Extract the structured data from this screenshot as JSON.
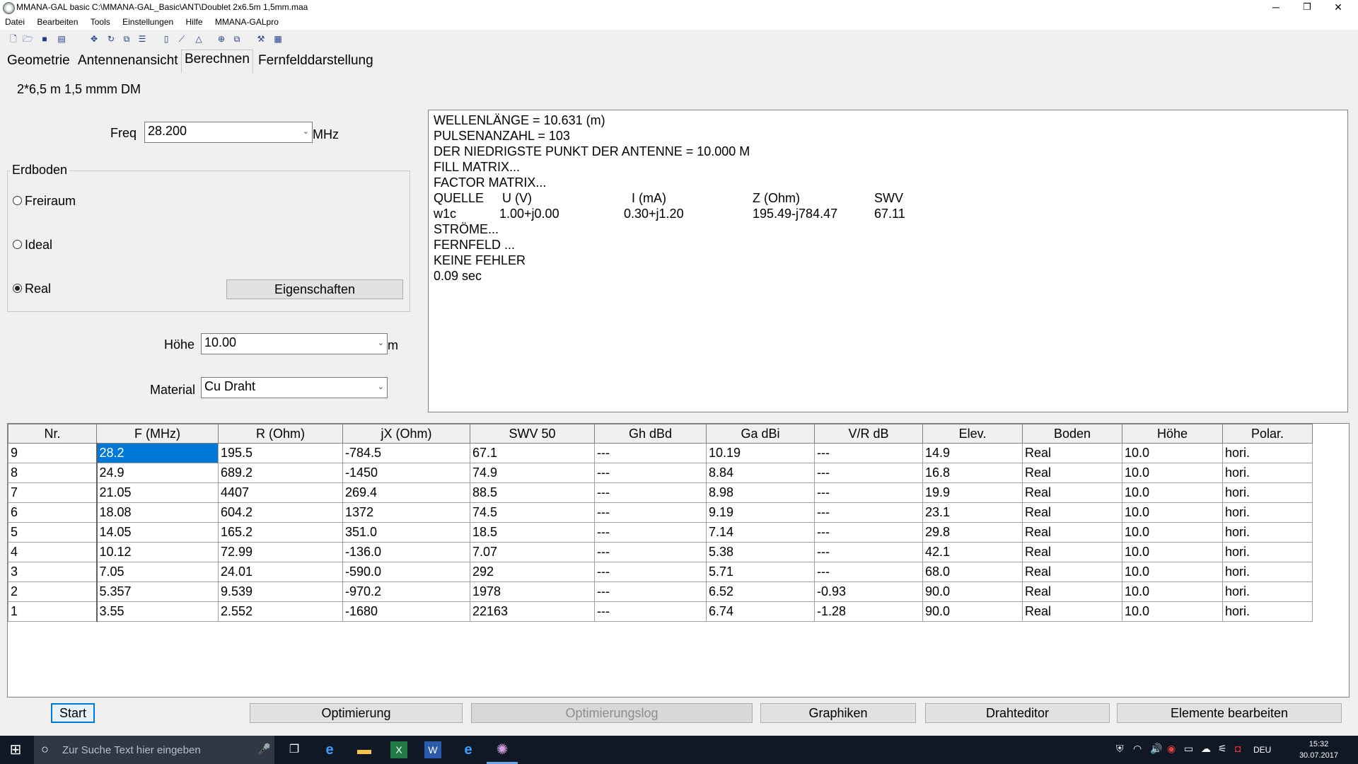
{
  "window": {
    "title": "MMANA-GAL basic C:\\MMANA-GAL_Basic\\ANT\\Doublet 2x6.5m 1,5mm.maa",
    "min": "─",
    "restore": "❐",
    "close": "✕"
  },
  "menu": [
    "Datei",
    "Bearbeiten",
    "Tools",
    "Einstellungen",
    "Hilfe",
    "MMANA-GALpro"
  ],
  "tabs": [
    "Geometrie",
    "Antennenansicht",
    "Berechnen",
    "Fernfelddarstellung"
  ],
  "active_tab": "Berechnen",
  "antenna_name": "2*6,5 m 1,5 mmm DM",
  "freq": {
    "label": "Freq",
    "value": "28.200",
    "unit": "MHz"
  },
  "ground": {
    "title": "Erdboden",
    "options": [
      "Freiraum",
      "Ideal",
      "Real"
    ],
    "selected": "Real",
    "properties_button": "Eigenschaften"
  },
  "height": {
    "label": "Höhe",
    "value": "10.00",
    "unit": "m"
  },
  "material": {
    "label": "Material",
    "value": "Cu Draht"
  },
  "output": {
    "lines": [
      "WELLENLÄNGE = 10.631 (m)",
      "PULSENANZAHL = 103",
      "DER NIEDRIGSTE PUNKT DER ANTENNE = 10.000 M",
      "FILL MATRIX...",
      "FACTOR MATRIX..."
    ],
    "source_header": [
      "QUELLE",
      "U (V)",
      "I (mA)",
      "Z (Ohm)",
      "SWV"
    ],
    "source_row": [
      "w1c",
      "1.00+j0.00",
      "0.30+j1.20",
      "195.49-j784.47",
      "67.11"
    ],
    "lines_after": [
      "STRÖME...",
      "FERNFELD ...",
      "KEINE FEHLER",
      "0.09 sec"
    ]
  },
  "table": {
    "headers": [
      "Nr.",
      "F (MHz)",
      "R (Ohm)",
      "jX (Ohm)",
      "SWV 50",
      "Gh dBd",
      "Ga dBi",
      "V/R dB",
      "Elev.",
      "Boden",
      "Höhe",
      "Polar."
    ],
    "rows": [
      [
        "9",
        "28.2",
        "195.5",
        "-784.5",
        "67.1",
        "---",
        "10.19",
        "---",
        "14.9",
        "Real",
        "10.0",
        "hori."
      ],
      [
        "8",
        "24.9",
        "689.2",
        "-1450",
        "74.9",
        "---",
        "8.84",
        "---",
        "16.8",
        "Real",
        "10.0",
        "hori."
      ],
      [
        "7",
        "21.05",
        "4407",
        "269.4",
        "88.5",
        "---",
        "8.98",
        "---",
        "19.9",
        "Real",
        "10.0",
        "hori."
      ],
      [
        "6",
        "18.08",
        "604.2",
        "1372",
        "74.5",
        "---",
        "9.19",
        "---",
        "23.1",
        "Real",
        "10.0",
        "hori."
      ],
      [
        "5",
        "14.05",
        "165.2",
        "351.0",
        "18.5",
        "---",
        "7.14",
        "---",
        "29.8",
        "Real",
        "10.0",
        "hori."
      ],
      [
        "4",
        "10.12",
        "72.99",
        "-136.0",
        "7.07",
        "---",
        "5.38",
        "---",
        "42.1",
        "Real",
        "10.0",
        "hori."
      ],
      [
        "3",
        "7.05",
        "24.01",
        "-590.0",
        "292",
        "---",
        "5.71",
        "---",
        "68.0",
        "Real",
        "10.0",
        "hori."
      ],
      [
        "2",
        "5.357",
        "9.539",
        "-970.2",
        "1978",
        "---",
        "6.52",
        "-0.93",
        "90.0",
        "Real",
        "10.0",
        "hori."
      ],
      [
        "1",
        "3.55",
        "2.552",
        "-1680",
        "22163",
        "---",
        "6.74",
        "-1.28",
        "90.0",
        "Real",
        "10.0",
        "hori."
      ]
    ]
  },
  "buttons": {
    "start": "Start",
    "optimize": "Optimierung",
    "optlog": "Optimierungslog",
    "graphics": "Graphiken",
    "wire_editor": "Drahteditor",
    "edit_elements": "Elemente bearbeiten"
  },
  "taskbar": {
    "search_placeholder": "Zur Suche Text hier eingeben",
    "lang": "DEU",
    "time": "15:32",
    "date": "30.07.2017"
  }
}
